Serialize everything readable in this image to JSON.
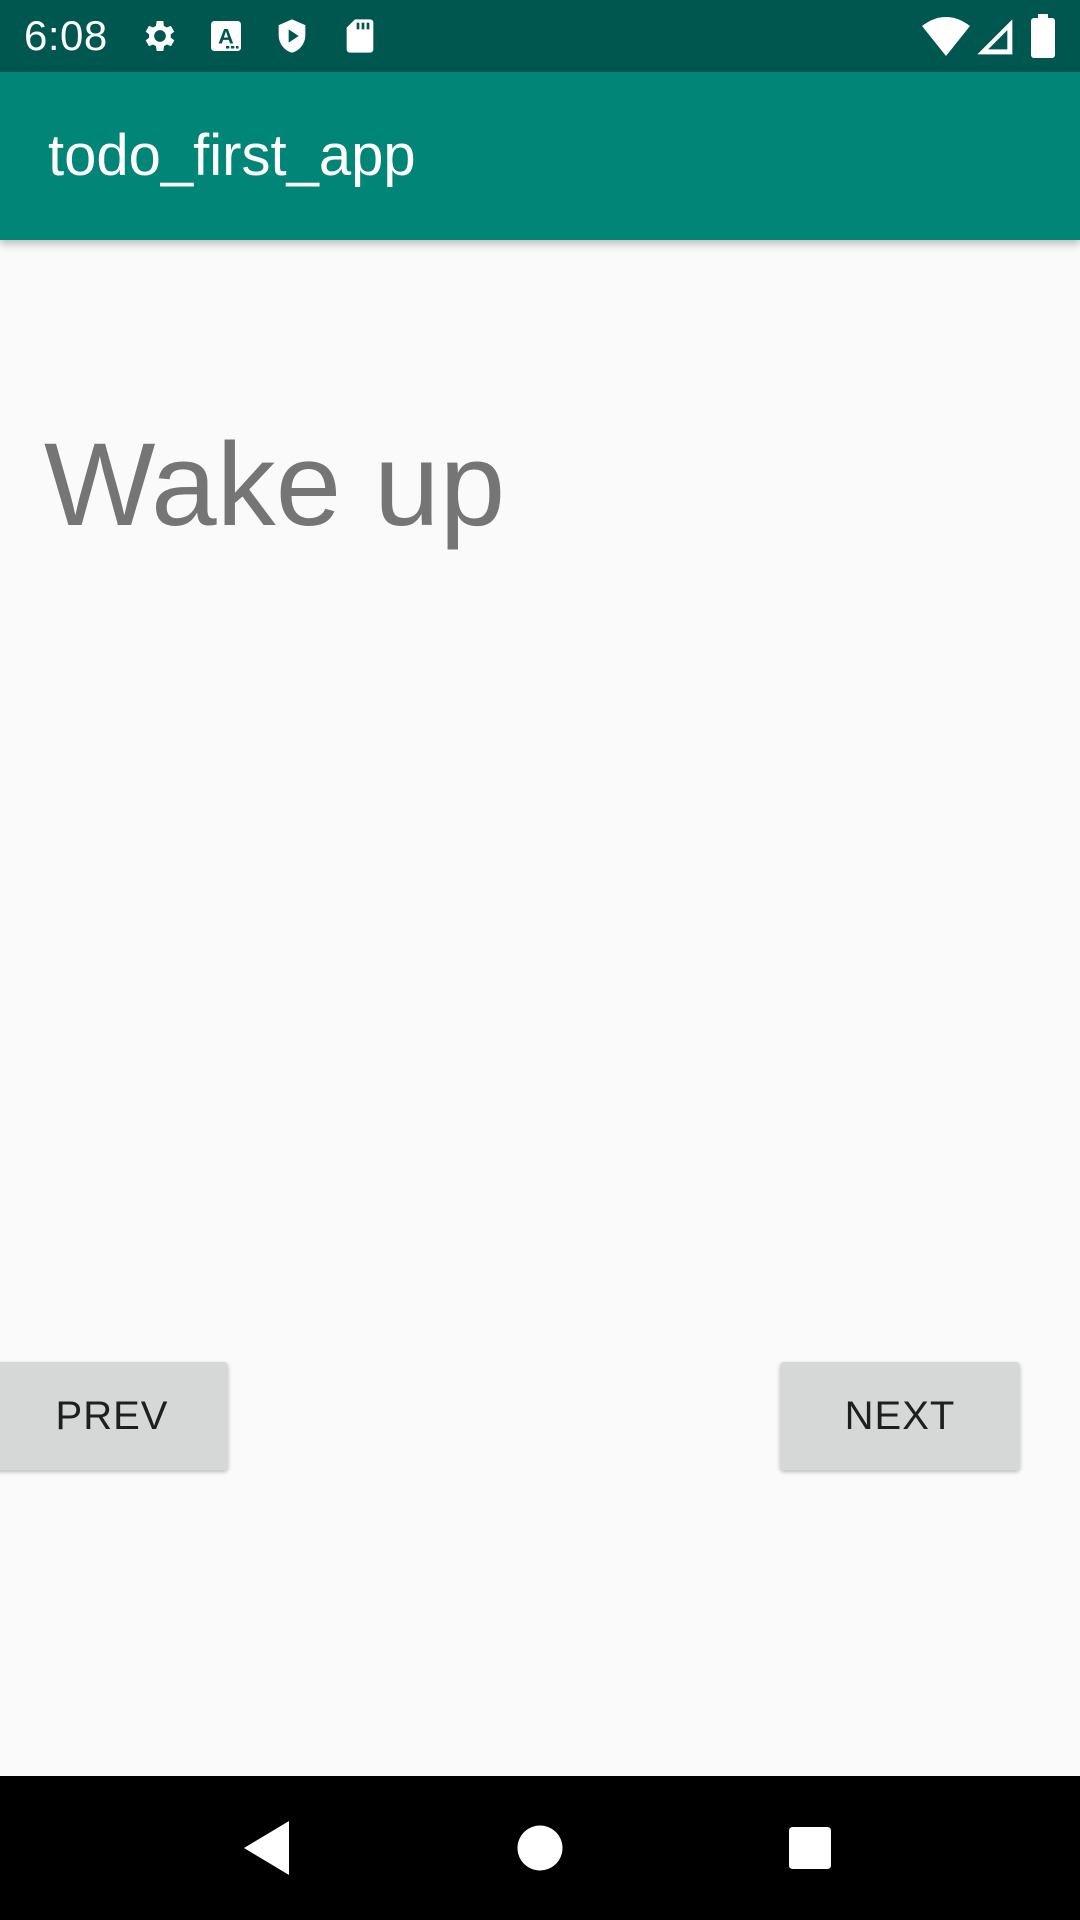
{
  "status_bar": {
    "time": "6:08",
    "icons": [
      "gear-icon",
      "a-font-icon",
      "shield-play-icon",
      "sd-card-icon",
      "wifi-icon",
      "signal-icon",
      "battery-icon"
    ]
  },
  "app_bar": {
    "title": "todo_first_app"
  },
  "content": {
    "task_text": "Wake up"
  },
  "buttons": {
    "prev_label": "PREV",
    "next_label": "NEXT"
  },
  "nav_bar": {
    "icons": [
      "back-icon",
      "home-icon",
      "recents-icon"
    ]
  },
  "colors": {
    "status_bar": "#00574F",
    "app_bar": "#018577",
    "background": "#FAFAFA",
    "button": "#D6D7D7",
    "task_text": "#757575"
  }
}
